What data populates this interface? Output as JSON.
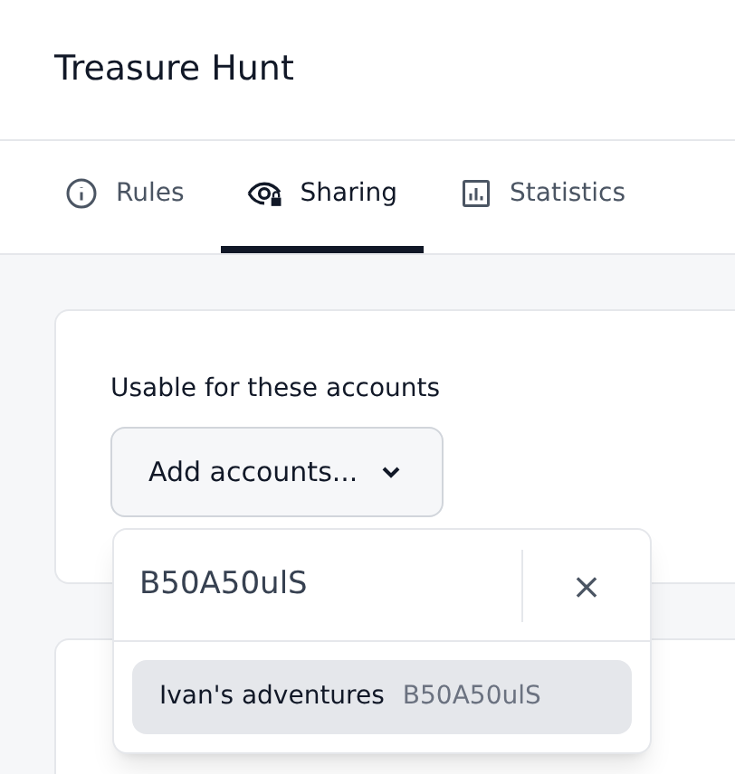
{
  "header": {
    "title": "Treasure Hunt"
  },
  "tabs": [
    {
      "label": "Rules",
      "kind": "info",
      "selected": false
    },
    {
      "label": "Sharing",
      "kind": "eye-lock",
      "selected": true
    },
    {
      "label": "Statistics",
      "kind": "chart",
      "selected": false
    }
  ],
  "accounts": {
    "label": "Usable for these accounts",
    "button": "Add accounts...",
    "expanded": true
  },
  "popover": {
    "search": {
      "value": "B50A50ulS"
    },
    "clear": "×",
    "options": [
      {
        "name": "Ivan's adventures",
        "code": "B50A50ulS",
        "highlighted": true
      }
    ]
  }
}
